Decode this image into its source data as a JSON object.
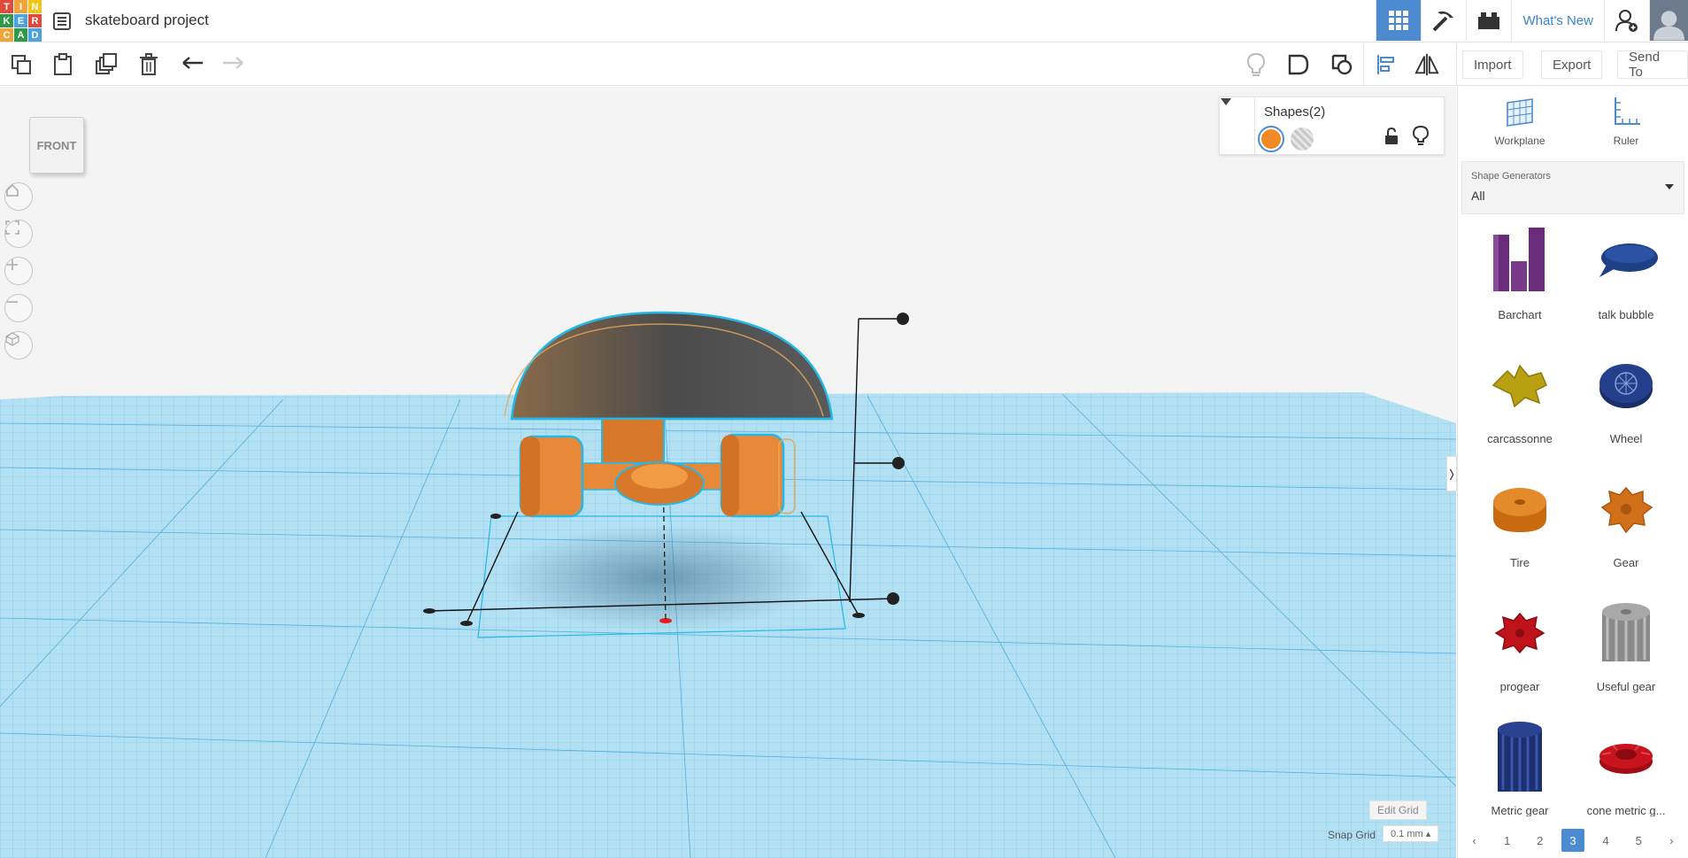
{
  "logo": {
    "letters": [
      "T",
      "I",
      "N",
      "K",
      "E",
      "R",
      "C",
      "A",
      "D"
    ],
    "colors": [
      "#e14a3b",
      "#f0a43a",
      "#f0c419",
      "#2f9b4a",
      "#4aa3df",
      "#e14a3b",
      "#f0a43a",
      "#2f9b4a",
      "#4aa3df"
    ]
  },
  "header": {
    "project_title": "skateboard project",
    "whats_new": "What's New",
    "icons": [
      "grid-view-icon",
      "pickaxe-icon",
      "bricks-icon",
      "add-user-icon",
      "avatar"
    ]
  },
  "toolbar": {
    "import_label": "Import",
    "export_label": "Export",
    "send_to_label": "Send To"
  },
  "viewport": {
    "viewcube_label": "FRONT",
    "accent": "#25b8e6"
  },
  "shapes_panel": {
    "title": "Shapes(2)",
    "solid_color": "#f28a24"
  },
  "grid_controls": {
    "edit_grid": "Edit Grid",
    "snap_grid_label": "Snap Grid",
    "snap_grid_value": "0.1 mm ▴"
  },
  "right_panel": {
    "workplane_label": "Workplane",
    "ruler_label": "Ruler",
    "generators_caption": "Shape Generators",
    "generators_value": "All",
    "shapes": [
      {
        "name": "Barchart",
        "icon": "barchart"
      },
      {
        "name": "talk bubble",
        "icon": "talk-bubble"
      },
      {
        "name": "carcassonne",
        "icon": "carcassonne"
      },
      {
        "name": "Wheel",
        "icon": "wheel"
      },
      {
        "name": "Tire",
        "icon": "tire"
      },
      {
        "name": "Gear",
        "icon": "gear"
      },
      {
        "name": "progear",
        "icon": "progear"
      },
      {
        "name": "Useful gear",
        "icon": "useful-gear"
      },
      {
        "name": "Metric gear",
        "icon": "metric-gear"
      },
      {
        "name": "cone metric g...",
        "icon": "cone-metric-gear"
      }
    ],
    "pages": [
      "1",
      "2",
      "3",
      "4",
      "5"
    ],
    "active_page": "3"
  }
}
